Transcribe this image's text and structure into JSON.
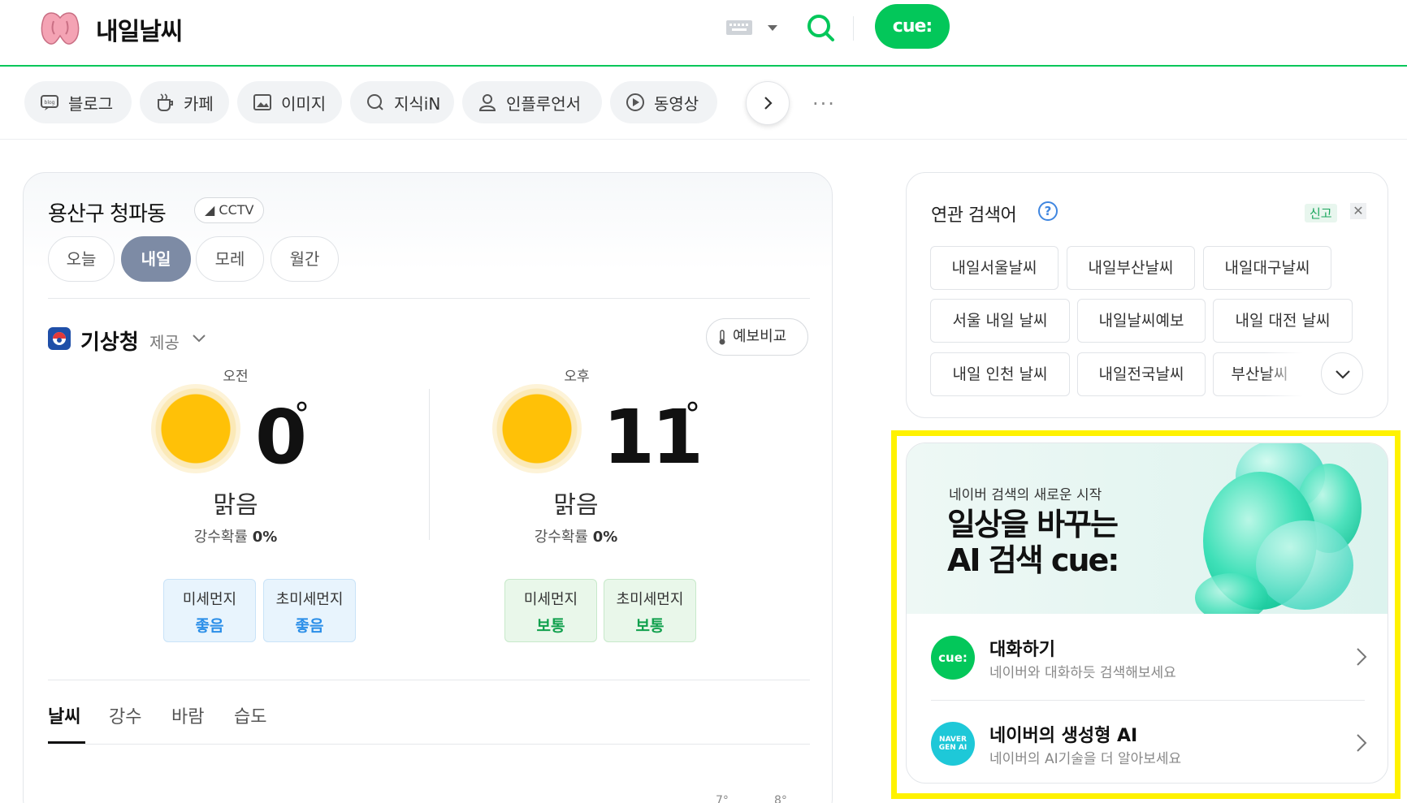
{
  "header": {
    "query": "내일날씨",
    "cue_label": "cue:",
    "icons": [
      "keyboard-icon",
      "search-icon"
    ]
  },
  "tabs": [
    {
      "label": "블로그",
      "icon": "blog-icon"
    },
    {
      "label": "카페",
      "icon": "cafe-icon"
    },
    {
      "label": "이미지",
      "icon": "image-icon"
    },
    {
      "label": "지식iN",
      "icon": "kin-icon"
    },
    {
      "label": "인플루언서",
      "icon": "influencer-icon"
    },
    {
      "label": "동영상",
      "icon": "video-icon"
    }
  ],
  "tabs_more": "···",
  "weather": {
    "location": "용산구 청파동",
    "cctv": "CCTV",
    "days": [
      "오늘",
      "내일",
      "모레",
      "월간"
    ],
    "active_day": "내일",
    "provider": "기상청",
    "provider_sub": "제공",
    "compare": "예보비교",
    "am": {
      "period": "오전",
      "temp": "0",
      "condition": "맑음",
      "rain_label": "강수확률",
      "rain_value": "0%",
      "dust": [
        {
          "label": "미세먼지",
          "value": "좋음"
        },
        {
          "label": "초미세먼지",
          "value": "좋음"
        }
      ]
    },
    "pm": {
      "period": "오후",
      "temp": "11",
      "condition": "맑음",
      "rain_label": "강수확률",
      "rain_value": "0%",
      "dust": [
        {
          "label": "미세먼지",
          "value": "보통"
        },
        {
          "label": "초미세먼지",
          "value": "보통"
        }
      ]
    },
    "subtabs": [
      "날씨",
      "강수",
      "바람",
      "습도"
    ],
    "chart_ticks": [
      "7°",
      "8°"
    ]
  },
  "related": {
    "title": "연관 검색어",
    "help": "?",
    "report": "신고",
    "close": "✕",
    "keywords": [
      "내일서울날씨",
      "내일부산날씨",
      "내일대구날씨",
      "서울 내일 날씨",
      "내일날씨예보",
      "내일 대전 날씨",
      "내일 인천 날씨",
      "내일전국날씨",
      "부산날씨"
    ]
  },
  "promo": {
    "banner_sub": "네이버 검색의 새로운 시작",
    "banner_line1": "일상을 바꾸는",
    "banner_line2": "AI 검색 cue:",
    "items": [
      {
        "title": "대화하기",
        "sub": "네이버와 대화하듯 검색해보세요",
        "icon_text": "cue:"
      },
      {
        "title": "네이버의 생성형 AI",
        "sub": "네이버의 AI기술을 더 알아보세요",
        "icon_text": "NAVER GEN AI"
      }
    ]
  },
  "colors": {
    "naver_green": "#03c75a",
    "highlight": "#fff200",
    "active_day": "#7d8ba5"
  }
}
